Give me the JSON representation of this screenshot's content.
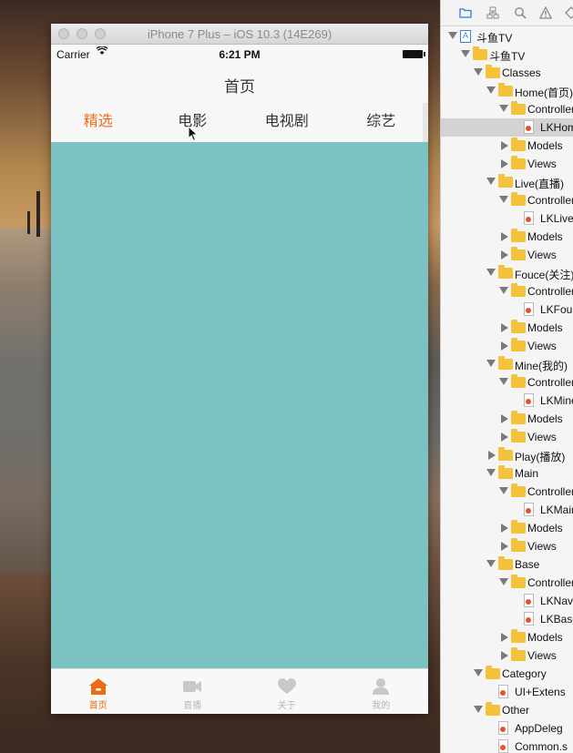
{
  "simulator": {
    "title": "iPhone 7 Plus – iOS 10.3 (14E269)",
    "status": {
      "carrier": "Carrier",
      "wifi": "wifi",
      "time": "6:21 PM"
    },
    "nav_title": "首页",
    "tabs": [
      {
        "label": "精选",
        "active": true
      },
      {
        "label": "电影",
        "active": false
      },
      {
        "label": "电视剧",
        "active": false
      },
      {
        "label": "综艺",
        "active": false
      }
    ],
    "content_color": "#7dc2c3",
    "accent_color": "#ec6b16",
    "tabbar": [
      {
        "label": "首页",
        "icon": "home-icon",
        "active": true
      },
      {
        "label": "直播",
        "icon": "video-camera-icon",
        "active": false
      },
      {
        "label": "关于",
        "icon": "heart-icon",
        "active": false
      },
      {
        "label": "我的",
        "icon": "person-icon",
        "active": false
      }
    ]
  },
  "navigator": {
    "toolbar_icons": [
      "folder-icon",
      "hierarchy-icon",
      "search-icon",
      "warning-icon",
      "diamond-icon"
    ],
    "items": [
      {
        "label": "斗鱼TV",
        "depth": 0,
        "kind": "project",
        "disclosure": "open"
      },
      {
        "label": "斗鱼TV",
        "depth": 1,
        "kind": "folder",
        "disclosure": "open"
      },
      {
        "label": "Classes",
        "depth": 2,
        "kind": "folder",
        "disclosure": "open"
      },
      {
        "label": "Home(首页)",
        "depth": 3,
        "kind": "folder",
        "disclosure": "open"
      },
      {
        "label": "Controller",
        "depth": 4,
        "kind": "folder",
        "disclosure": "open"
      },
      {
        "label": "LKHom",
        "depth": 5,
        "kind": "file",
        "disclosure": "none",
        "selected": true
      },
      {
        "label": "Models",
        "depth": 4,
        "kind": "folder",
        "disclosure": "closed"
      },
      {
        "label": "Views",
        "depth": 4,
        "kind": "folder",
        "disclosure": "closed"
      },
      {
        "label": "Live(直播)",
        "depth": 3,
        "kind": "folder",
        "disclosure": "open"
      },
      {
        "label": "Controller",
        "depth": 4,
        "kind": "folder",
        "disclosure": "open"
      },
      {
        "label": "LKLive\\",
        "depth": 5,
        "kind": "file",
        "disclosure": "none"
      },
      {
        "label": "Models",
        "depth": 4,
        "kind": "folder",
        "disclosure": "closed"
      },
      {
        "label": "Views",
        "depth": 4,
        "kind": "folder",
        "disclosure": "closed"
      },
      {
        "label": "Fouce(关注)",
        "depth": 3,
        "kind": "folder",
        "disclosure": "open"
      },
      {
        "label": "Controller",
        "depth": 4,
        "kind": "folder",
        "disclosure": "open"
      },
      {
        "label": "LKFouc",
        "depth": 5,
        "kind": "file",
        "disclosure": "none"
      },
      {
        "label": "Models",
        "depth": 4,
        "kind": "folder",
        "disclosure": "closed"
      },
      {
        "label": "Views",
        "depth": 4,
        "kind": "folder",
        "disclosure": "closed"
      },
      {
        "label": "Mine(我的)",
        "depth": 3,
        "kind": "folder",
        "disclosure": "open"
      },
      {
        "label": "Controller",
        "depth": 4,
        "kind": "folder",
        "disclosure": "open"
      },
      {
        "label": "LKMine",
        "depth": 5,
        "kind": "file",
        "disclosure": "none"
      },
      {
        "label": "Models",
        "depth": 4,
        "kind": "folder",
        "disclosure": "closed"
      },
      {
        "label": "Views",
        "depth": 4,
        "kind": "folder",
        "disclosure": "closed"
      },
      {
        "label": "Play(播放)",
        "depth": 3,
        "kind": "folder",
        "disclosure": "closed"
      },
      {
        "label": "Main",
        "depth": 3,
        "kind": "folder",
        "disclosure": "open"
      },
      {
        "label": "Controller",
        "depth": 4,
        "kind": "folder",
        "disclosure": "open"
      },
      {
        "label": "LKMain",
        "depth": 5,
        "kind": "file",
        "disclosure": "none"
      },
      {
        "label": "Models",
        "depth": 4,
        "kind": "folder",
        "disclosure": "closed"
      },
      {
        "label": "Views",
        "depth": 4,
        "kind": "folder",
        "disclosure": "closed"
      },
      {
        "label": "Base",
        "depth": 3,
        "kind": "folder",
        "disclosure": "open"
      },
      {
        "label": "Controller",
        "depth": 4,
        "kind": "folder",
        "disclosure": "open"
      },
      {
        "label": "LKNavig",
        "depth": 5,
        "kind": "file",
        "disclosure": "none"
      },
      {
        "label": "LKBase",
        "depth": 5,
        "kind": "file",
        "disclosure": "none"
      },
      {
        "label": "Models",
        "depth": 4,
        "kind": "folder",
        "disclosure": "closed"
      },
      {
        "label": "Views",
        "depth": 4,
        "kind": "folder",
        "disclosure": "closed"
      },
      {
        "label": "Category",
        "depth": 2,
        "kind": "folder",
        "disclosure": "open"
      },
      {
        "label": "UI+Extens",
        "depth": 3,
        "kind": "file",
        "disclosure": "none"
      },
      {
        "label": "Other",
        "depth": 2,
        "kind": "folder",
        "disclosure": "open"
      },
      {
        "label": "AppDeleg",
        "depth": 3,
        "kind": "file",
        "disclosure": "none"
      },
      {
        "label": "Common.s",
        "depth": 3,
        "kind": "file",
        "disclosure": "none"
      }
    ]
  }
}
